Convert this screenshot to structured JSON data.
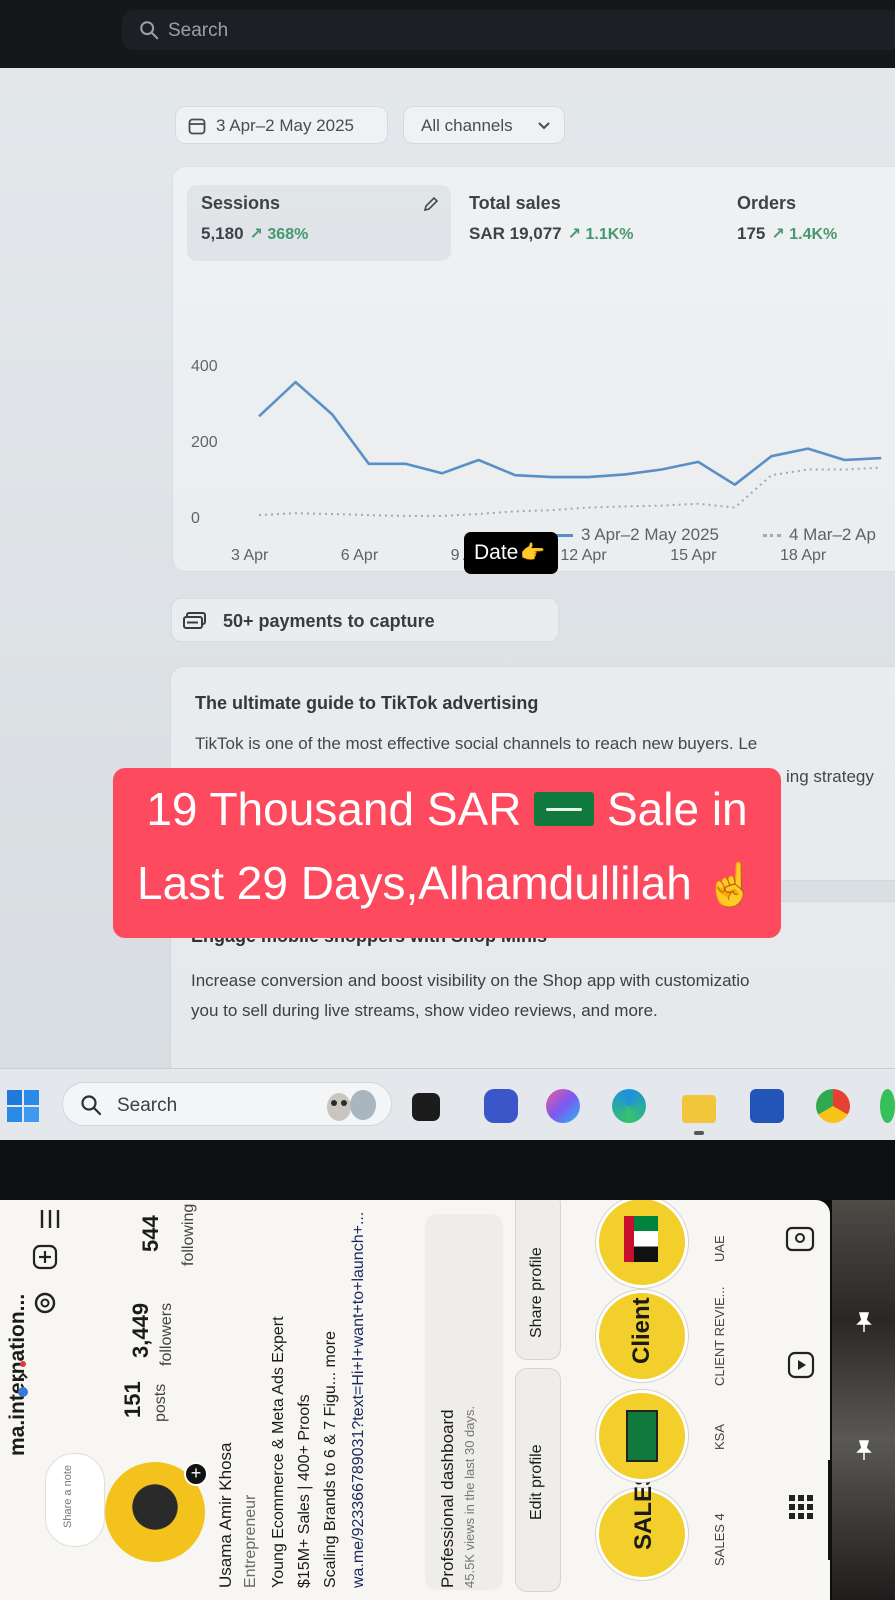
{
  "browser": {
    "search_label": "Search"
  },
  "filters": {
    "date_range": "3 Apr–2 May 2025",
    "channel": "All channels"
  },
  "metrics": [
    {
      "name": "Sessions",
      "value": "5,180",
      "change": "368%"
    },
    {
      "name": "Total sales",
      "value": "SAR 19,077",
      "change": "1.1K%"
    },
    {
      "name": "Orders",
      "value": "175",
      "change": "1.4K%"
    }
  ],
  "chart_data": {
    "type": "line",
    "x": [
      "3 Apr",
      "4 Apr",
      "5 Apr",
      "6 Apr",
      "7 Apr",
      "8 Apr",
      "9 Apr",
      "10 Apr",
      "11 Apr",
      "12 Apr",
      "13 Apr",
      "14 Apr",
      "15 Apr",
      "16 Apr",
      "17 Apr",
      "18 Apr",
      "19 Apr",
      "20 Apr"
    ],
    "xticks": [
      "3 Apr",
      "6 Apr",
      "9 Apr",
      "12 Apr",
      "15 Apr",
      "18 Apr"
    ],
    "yticks": [
      "0",
      "200",
      "400"
    ],
    "ylim": [
      0,
      400
    ],
    "series": [
      {
        "name": "3 Apr–2 May 2025",
        "style": "solid",
        "color": "#4a86c5",
        "values": [
          265,
          355,
          270,
          140,
          140,
          115,
          150,
          110,
          105,
          105,
          112,
          125,
          145,
          85,
          160,
          180,
          150,
          155
        ]
      },
      {
        "name": "4 Mar–2 Ap",
        "style": "dotted",
        "color": "#9aa4ae",
        "values": [
          5,
          10,
          8,
          5,
          3,
          3,
          8,
          15,
          18,
          25,
          28,
          30,
          35,
          25,
          110,
          125,
          125,
          130
        ]
      }
    ]
  },
  "legend": {
    "badge": "Date",
    "badge_emoji": "👉",
    "current": "3 Apr–2 May 2025",
    "previous": "4 Mar–2 Ap"
  },
  "payments": {
    "label": "50+ payments to capture"
  },
  "guide": {
    "title": "The ultimate guide to TikTok advertising",
    "body": "TikTok is one of the most effective social channels to reach new buyers. Le",
    "body_tail": "ing strategy"
  },
  "minis": {
    "title": "Engage mobile shoppers with Shop Minis",
    "line1": "Increase conversion and boost visibility on the Shop app with customizatio",
    "line2": "you to sell during live streams, show video reviews, and more."
  },
  "taskbar": {
    "search_label": "Search"
  },
  "banner": {
    "line1_a": "19 Thousand SAR",
    "line1_b": "Sale in",
    "line2": "Last 29 Days,Alhamdullilah",
    "emoji": "☝️"
  },
  "instagram": {
    "username": "ma.internation...",
    "share_note": "Share a note",
    "stats": [
      {
        "value": "151",
        "label": "posts"
      },
      {
        "value": "3,449",
        "label": "followers"
      },
      {
        "value": "544",
        "label": "following"
      }
    ],
    "name": "Usama Amir Khosa",
    "category": "Entrepreneur",
    "bio": [
      "Young Ecommerce & Meta Ads Expert",
      "$15M+ Sales | 400+ Proofs",
      "Scaling Brands to 6 & 7 Figu... more",
      "wa.me/923366789031?text=Hi+I+want+to+launch+..."
    ],
    "dashboard": {
      "title": "Professional dashboard",
      "subtitle": "45.5K views in the last 30 days."
    },
    "buttons": {
      "edit": "Edit profile",
      "share": "Share profile"
    },
    "highlights": [
      {
        "label": "SALES 4",
        "art": "SALES"
      },
      {
        "label": "KSA",
        "art": ""
      },
      {
        "label": "CLIENT REVIE...",
        "art": "Client"
      },
      {
        "label": "UAE",
        "art": ""
      }
    ]
  }
}
